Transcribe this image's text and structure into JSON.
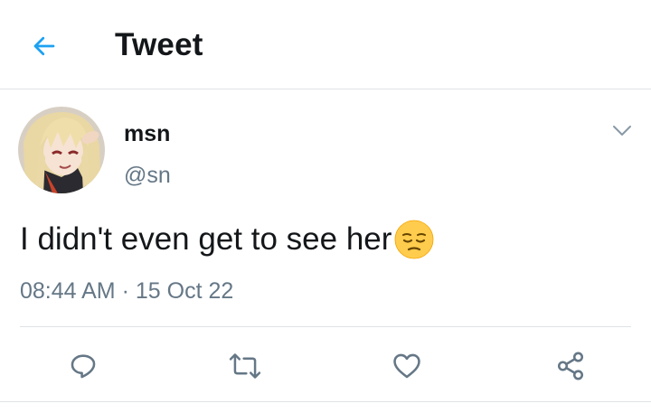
{
  "header": {
    "title": "Tweet",
    "back_icon": "arrow-left-icon"
  },
  "tweet": {
    "display_name": "msn",
    "handle": "@sn",
    "text": "I didn't even get to see her",
    "emoji": "pensive-face",
    "time": "08:44 AM",
    "separator": "·",
    "date": "15 Oct 22"
  },
  "actions": {
    "icons": [
      "reply-icon",
      "retweet-icon",
      "like-icon",
      "share-icon"
    ]
  },
  "colors": {
    "accent": "#1da1f2",
    "text": "#14171a",
    "secondary": "#657786",
    "icon": "#657786",
    "divider": "#dfe3e6"
  }
}
